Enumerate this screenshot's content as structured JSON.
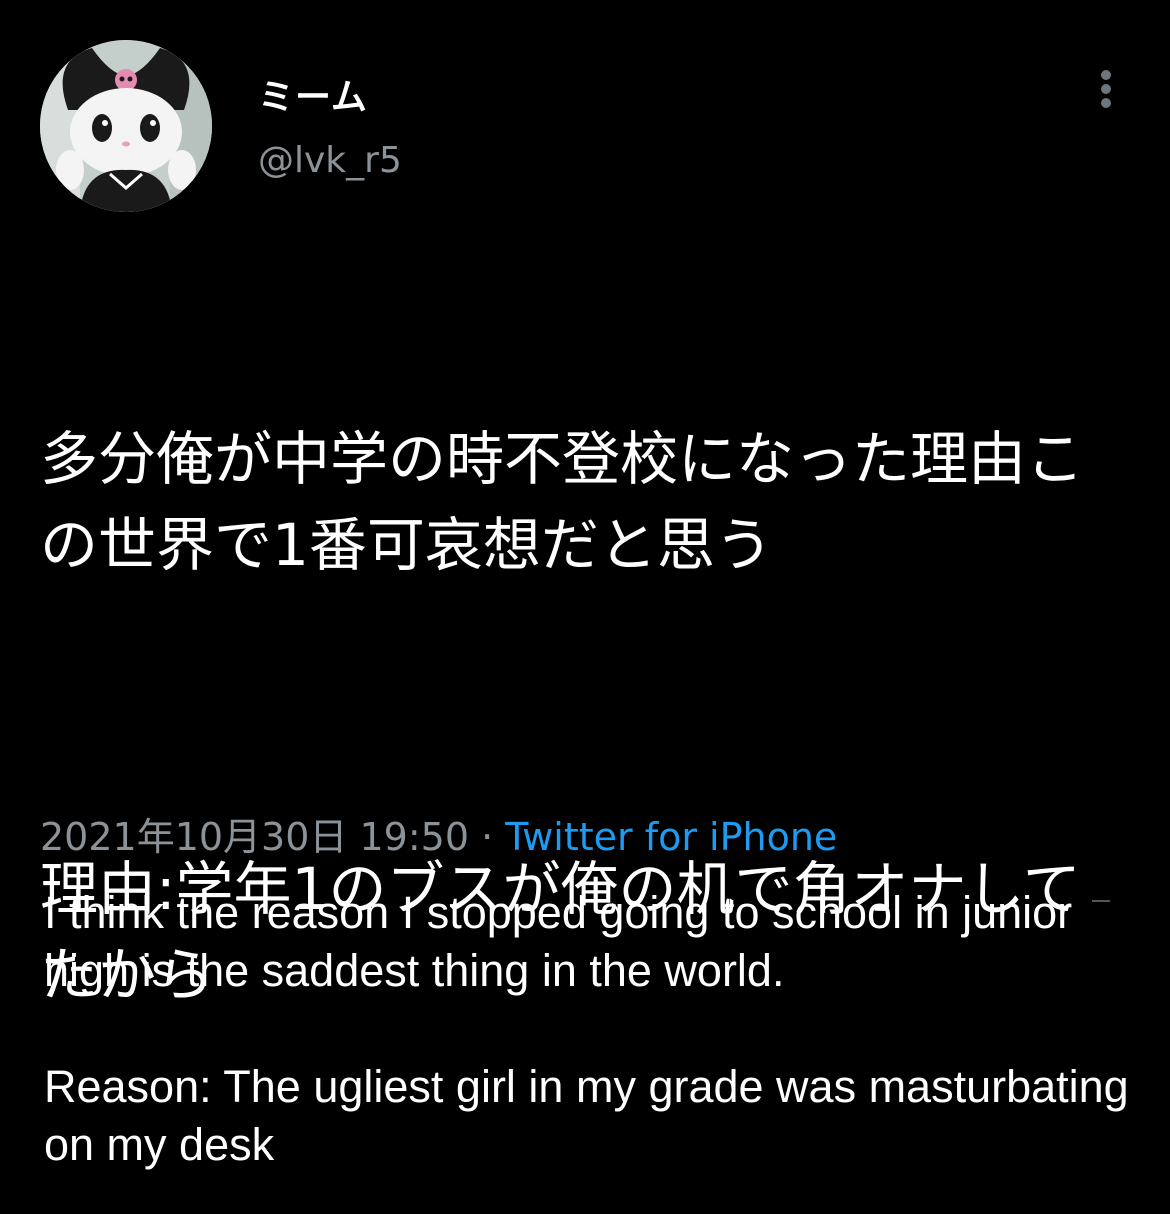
{
  "author": {
    "display_name": "ミーム",
    "handle": "@lvk_r5"
  },
  "icons": {
    "more": "more-vertical-icon",
    "avatar": "kuromi-avatar"
  },
  "tweet": {
    "paragraph_1": "多分俺が中学の時不登校になった理由この世界で1番可哀想だと思う",
    "paragraph_2": "理由:学年1のブスが俺の机で角オナしてたから"
  },
  "meta": {
    "timestamp": "2021年10月30日 19:50",
    "separator": " · ",
    "source": "Twitter for iPhone"
  },
  "translation": {
    "paragraph_1": "I think the reason I stopped going to school in junior high is the saddest thing in the world.",
    "paragraph_2": "Reason: The ugliest girl in my grade was masturbating on my desk"
  },
  "colors": {
    "background": "#000000",
    "text": "#ffffff",
    "secondary": "#8b9399",
    "accent": "#1d9bf0"
  }
}
